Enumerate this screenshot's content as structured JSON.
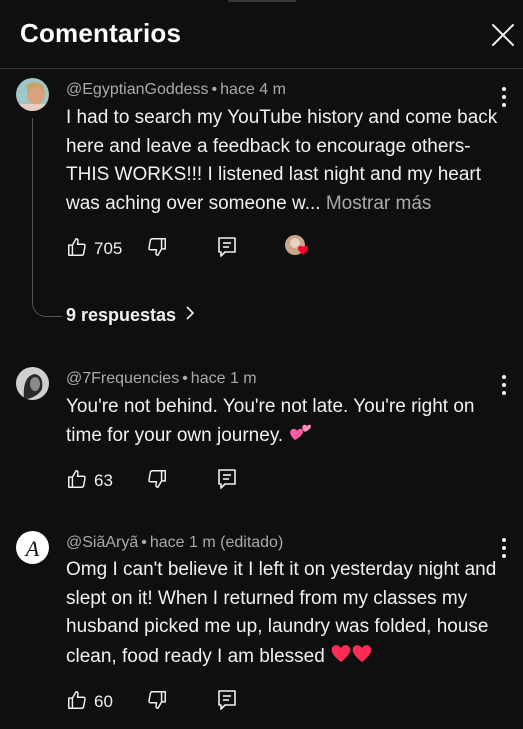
{
  "panel": {
    "title": "Comentarios",
    "close_icon": "close-icon"
  },
  "comments": [
    {
      "author": "@EgyptianGoddess",
      "separator": "•",
      "time": "hace 4 m",
      "text": "I had to search my YouTube history and come back here and leave a feedback to encourage others- THIS WORKS!!! I listened last night and my heart was aching over someone w...",
      "more": "Mostrar más",
      "likes": "705",
      "replies_label": "9 respuestas",
      "creator_heart": true
    },
    {
      "author": "@7Frequencies",
      "separator": "•",
      "time": "hace 1 m",
      "text": "You're not behind. You're not late. You're right on time for your own journey.",
      "emoji": "two-hearts",
      "likes": "63"
    },
    {
      "author": "@SiãAryã",
      "separator": "•",
      "time": "hace 1 m (editado)",
      "text": "Omg I can't believe it I left it on yesterday night and slept on it! When I returned from my classes my husband picked me up, laundry was folded, house clean, food ready I am blessed",
      "emoji": "red-hearts",
      "likes": "60"
    }
  ],
  "colors": {
    "background": "#0f0f0f",
    "text": "#f1f1f1",
    "secondary_text": "#aaaaaa",
    "heart": "#ff0033",
    "pink_emoji": "#ff5ca8"
  }
}
